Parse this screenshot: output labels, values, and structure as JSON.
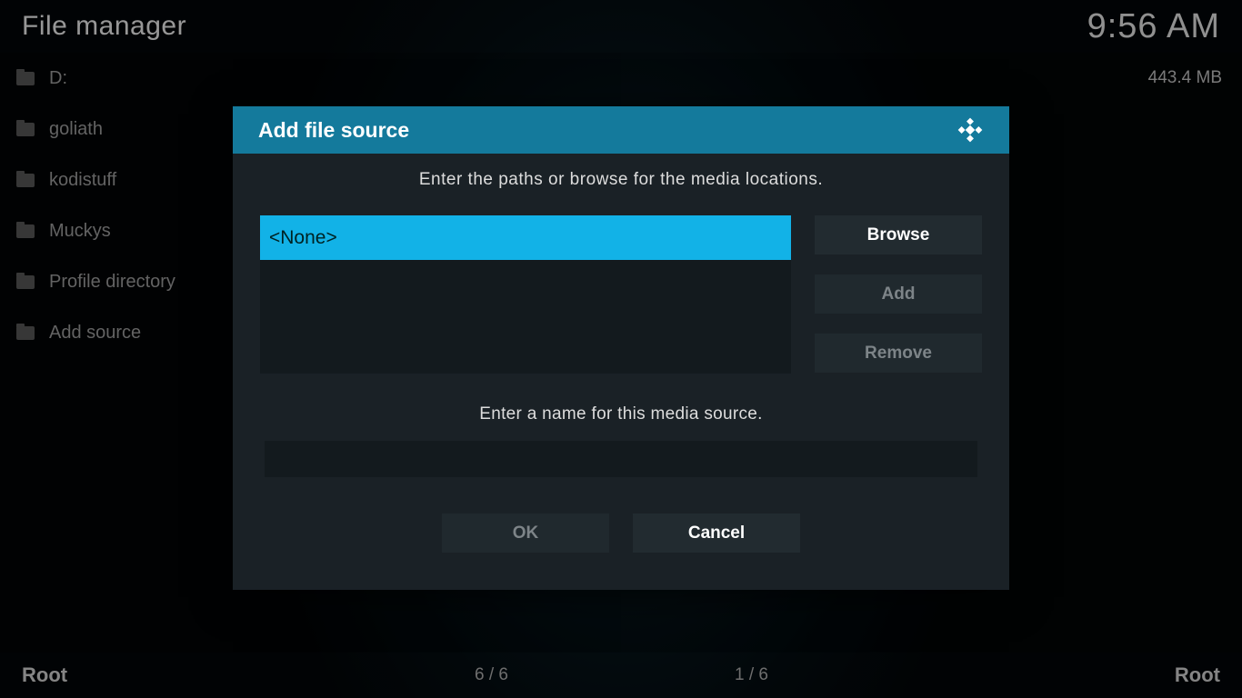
{
  "header": {
    "title": "File manager",
    "time": "9:56 AM"
  },
  "left_panel": {
    "items": [
      {
        "name": "D:",
        "size": "443.4 MB"
      },
      {
        "name": "goliath"
      },
      {
        "name": "kodistuff"
      },
      {
        "name": "Muckys"
      },
      {
        "name": "Profile directory"
      },
      {
        "name": "Add source"
      }
    ]
  },
  "footer": {
    "left_label": "Root",
    "left_count": "6 / 6",
    "right_count": "1 / 6",
    "right_label": "Root"
  },
  "dialog": {
    "title": "Add file source",
    "instruction_paths": "Enter the paths or browse for the media locations.",
    "path_value": "<None>",
    "browse_label": "Browse",
    "add_label": "Add",
    "remove_label": "Remove",
    "instruction_name": "Enter a name for this media source.",
    "name_value": "",
    "ok_label": "OK",
    "cancel_label": "Cancel"
  }
}
